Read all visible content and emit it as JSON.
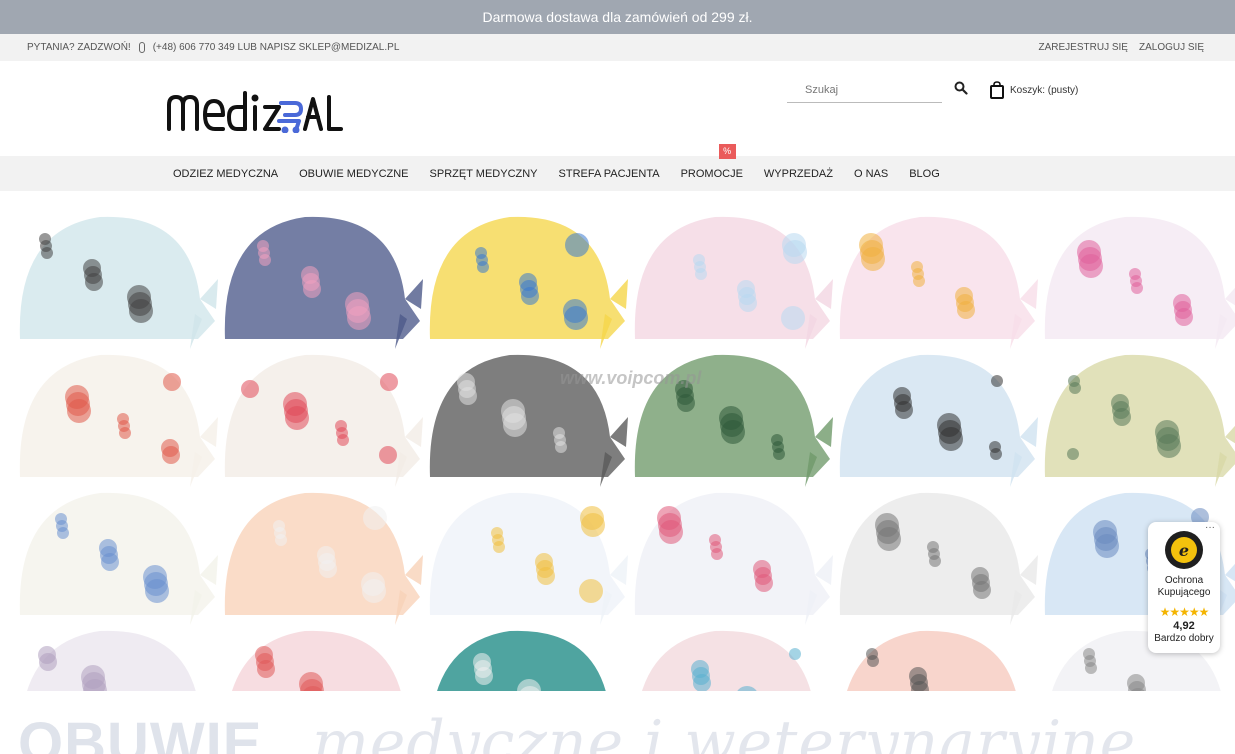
{
  "promo": {
    "text": "Darmowa dostawa dla zamówień od 299 zł."
  },
  "topbar": {
    "contact": "PYTANIA? ZADZWOŃ!",
    "phone": "(+48) 606 770 349 LUB NAPISZ SKLEP@MEDIZAL.PL",
    "register": "ZAREJESTRUJ SIĘ",
    "login": "ZALOGUJ SIĘ"
  },
  "header": {
    "logo_text": "MEDIZAL",
    "search_placeholder": "Szukaj",
    "cart_label": "Koszyk: (pusty)"
  },
  "nav": {
    "items": [
      {
        "label": "ODZIEZ MEDYCZNA"
      },
      {
        "label": "OBUWIE MEDYCZNE"
      },
      {
        "label": "SPRZĘT MEDYCZNY"
      },
      {
        "label": "STREFA PACJENTA"
      },
      {
        "label": "PROMOCJE",
        "badge": "%"
      },
      {
        "label": "WYPRZEDAŻ"
      },
      {
        "label": "O NAS"
      },
      {
        "label": "BLOG"
      }
    ]
  },
  "hero": {
    "watermark": "www.voipcom.pl",
    "caps": [
      {
        "color": "#cfe5ea",
        "accent": "#444444"
      },
      {
        "color": "#4d5a8a",
        "accent": "#f0a0c0"
      },
      {
        "color": "#f5d64a",
        "accent": "#3a7ad0"
      },
      {
        "color": "#f3d6e2",
        "accent": "#b8d8f0"
      },
      {
        "color": "#f7dde8",
        "accent": "#f0b040"
      },
      {
        "color": "#f4e8f2",
        "accent": "#e0609a"
      },
      {
        "color": "#f5f0e8",
        "accent": "#e05a4a"
      },
      {
        "color": "#f2ece6",
        "accent": "#e04a5a"
      },
      {
        "color": "#5a5a5a",
        "accent": "#e0e0e0"
      },
      {
        "color": "#6f9a6a",
        "accent": "#2f5a3a"
      },
      {
        "color": "#cfe2f0",
        "accent": "#333333"
      },
      {
        "color": "#d8d8a6",
        "accent": "#5a7a5a"
      },
      {
        "color": "#f3f2ea",
        "accent": "#6a8fd0"
      },
      {
        "color": "#f8d2b8",
        "accent": "#f0f0f0"
      },
      {
        "color": "#eef2f8",
        "accent": "#f0c040"
      },
      {
        "color": "#eef0f6",
        "accent": "#e05a7a"
      },
      {
        "color": "#e8e8e8",
        "accent": "#777777"
      },
      {
        "color": "#cde0f2",
        "accent": "#6a8ac0"
      },
      {
        "color": "#ebe5ee",
        "accent": "#b0a0c0"
      },
      {
        "color": "#f5d4d8",
        "accent": "#e05a5a"
      },
      {
        "color": "#1e8a85",
        "accent": "#f0f0f0"
      },
      {
        "color": "#f2d8dc",
        "accent": "#5ab0d0"
      },
      {
        "color": "#f6c9be",
        "accent": "#555555"
      },
      {
        "color": "#f0f0f4",
        "accent": "#888888"
      }
    ]
  },
  "trust_badge": {
    "title": "Ochrona Kupującego",
    "stars": "★★★★★",
    "score": "4,92",
    "rating": "Bardzo dobry"
  },
  "bottom_banner": {
    "bold_text": "OBUWIE",
    "script_text": "medyczne i weterynaryjne"
  },
  "colors": {
    "promo_bg": "#a0a7b1",
    "badge_red": "#ea5b5b",
    "logo_blue": "#4a69d8"
  }
}
